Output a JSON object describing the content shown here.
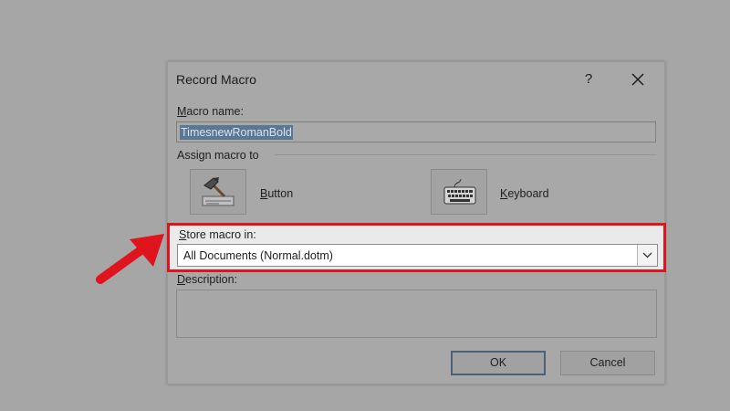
{
  "dialog": {
    "title": "Record Macro",
    "help_label": "?",
    "macro_name": {
      "label_accel": "M",
      "label_rest": "acro name:",
      "value": "TimesnewRomanBold"
    },
    "assign": {
      "group_label": "Assign macro to",
      "button": {
        "label_accel": "B",
        "label_rest": "utton",
        "icon": "hammer-icon"
      },
      "keyboard": {
        "label_accel": "K",
        "label_rest": "eyboard",
        "icon": "keyboard-icon"
      }
    },
    "store": {
      "label_accel": "S",
      "label_rest": "tore macro in:",
      "selected": "All Documents (Normal.dotm)"
    },
    "description": {
      "label_accel": "D",
      "label_rest": "escription:",
      "value": ""
    },
    "ok_label": "OK",
    "cancel_label": "Cancel"
  },
  "annotation": {
    "highlight_color": "#e0141c",
    "arrow_icon": "red-arrow-icon"
  }
}
